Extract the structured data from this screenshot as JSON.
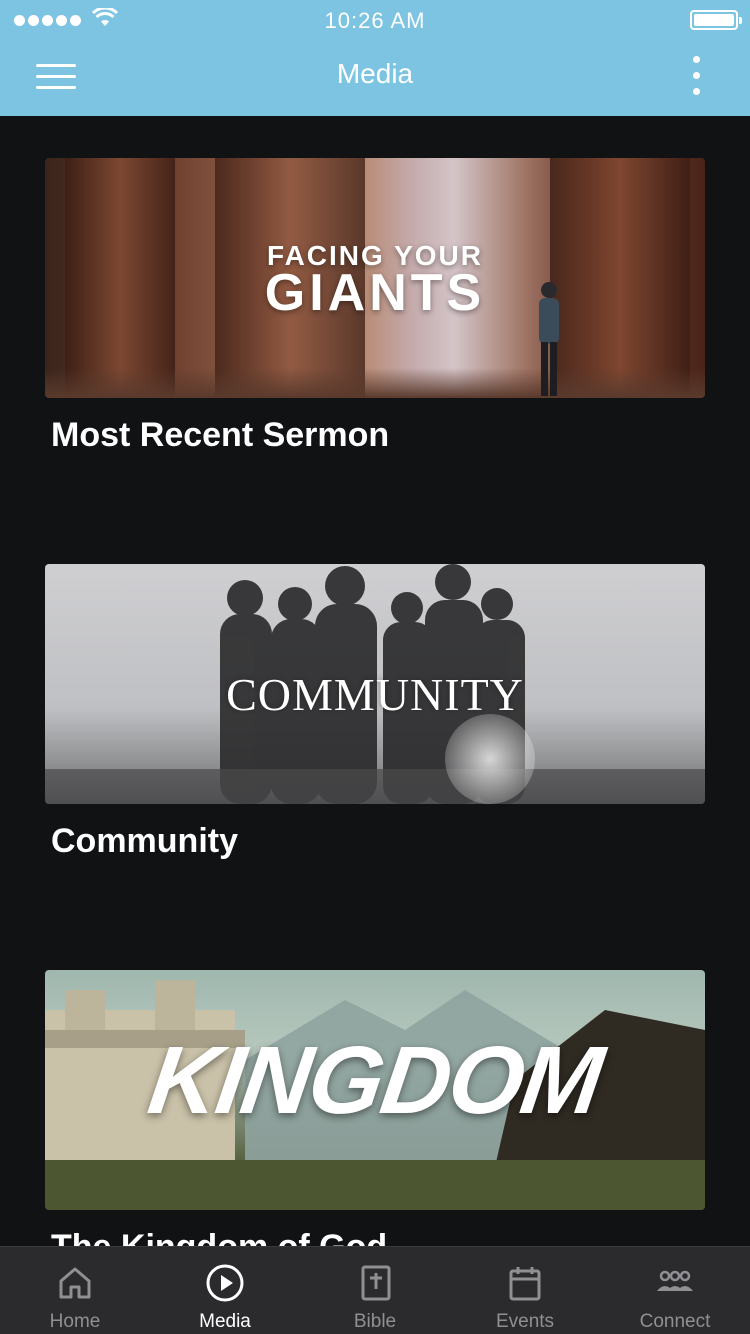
{
  "status_bar": {
    "time": "10:26 AM"
  },
  "header": {
    "title": "Media"
  },
  "cards": [
    {
      "title": "Most Recent Sermon",
      "banner_line1": "FACING YOUR",
      "banner_line2": "GIANTS"
    },
    {
      "title": "Community",
      "banner_text": "COMMUNITY"
    },
    {
      "title": "The Kingdom of God",
      "banner_text": "KINGDOM"
    }
  ],
  "tabbar": {
    "active": "Media",
    "tabs": [
      {
        "label": "Home",
        "icon": "home-icon"
      },
      {
        "label": "Media",
        "icon": "play-circle-icon"
      },
      {
        "label": "Bible",
        "icon": "bible-icon"
      },
      {
        "label": "Events",
        "icon": "calendar-icon"
      },
      {
        "label": "Connect",
        "icon": "people-icon"
      }
    ]
  },
  "colors": {
    "header_bg": "#7cc4e2",
    "content_bg": "#111214",
    "tabbar_bg": "#2b2b2d",
    "tab_inactive": "#8f8f94",
    "tab_active": "#ffffff"
  }
}
